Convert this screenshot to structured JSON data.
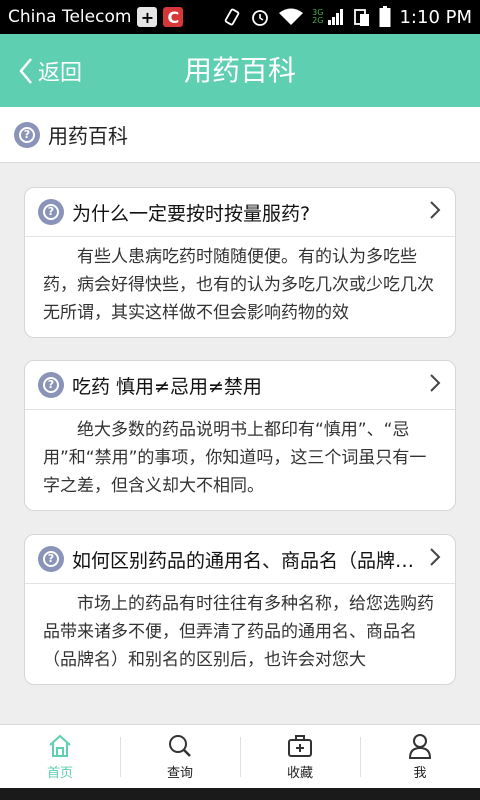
{
  "status_bar": {
    "carrier": "China Telecom",
    "plus_badge": "+",
    "c_badge": "C",
    "net_top": "3G",
    "net_bottom": "2G",
    "time": "1:10 PM"
  },
  "header": {
    "back_label": "返回",
    "title": "用药百科"
  },
  "section": {
    "title": "用药百科"
  },
  "articles": [
    {
      "title": "为什么一定要按时按量服药?",
      "summary": "有些人患病吃药时随随便便。有的认为多吃些药，病会好得快些，也有的认为多吃几次或少吃几次无所谓，其实这样做不但会影响药物的效"
    },
    {
      "title": "吃药 慎用≠忌用≠禁用",
      "summary": "绝大多数的药品说明书上都印有“慎用”、“忌用”和“禁用”的事项，你知道吗，这三个词虽只有一字之差，但含义却大不相同。"
    },
    {
      "title": "如何区别药品的通用名、商品名（品牌名）和别名",
      "summary": "市场上的药品有时往往有多种名称，给您选购药品带来诸多不便，但弄清了药品的通用名、商品名（品牌名）和别名的区别后，也许会对您大"
    }
  ],
  "tabs": [
    {
      "label": "首页",
      "icon": "home-icon",
      "active": true
    },
    {
      "label": "查询",
      "icon": "search-icon",
      "active": false
    },
    {
      "label": "收藏",
      "icon": "favorites-icon",
      "active": false
    },
    {
      "label": "我",
      "icon": "user-icon",
      "active": false
    }
  ],
  "colors": {
    "accent": "#5fcfb1",
    "question_icon": "#8a93b8"
  }
}
